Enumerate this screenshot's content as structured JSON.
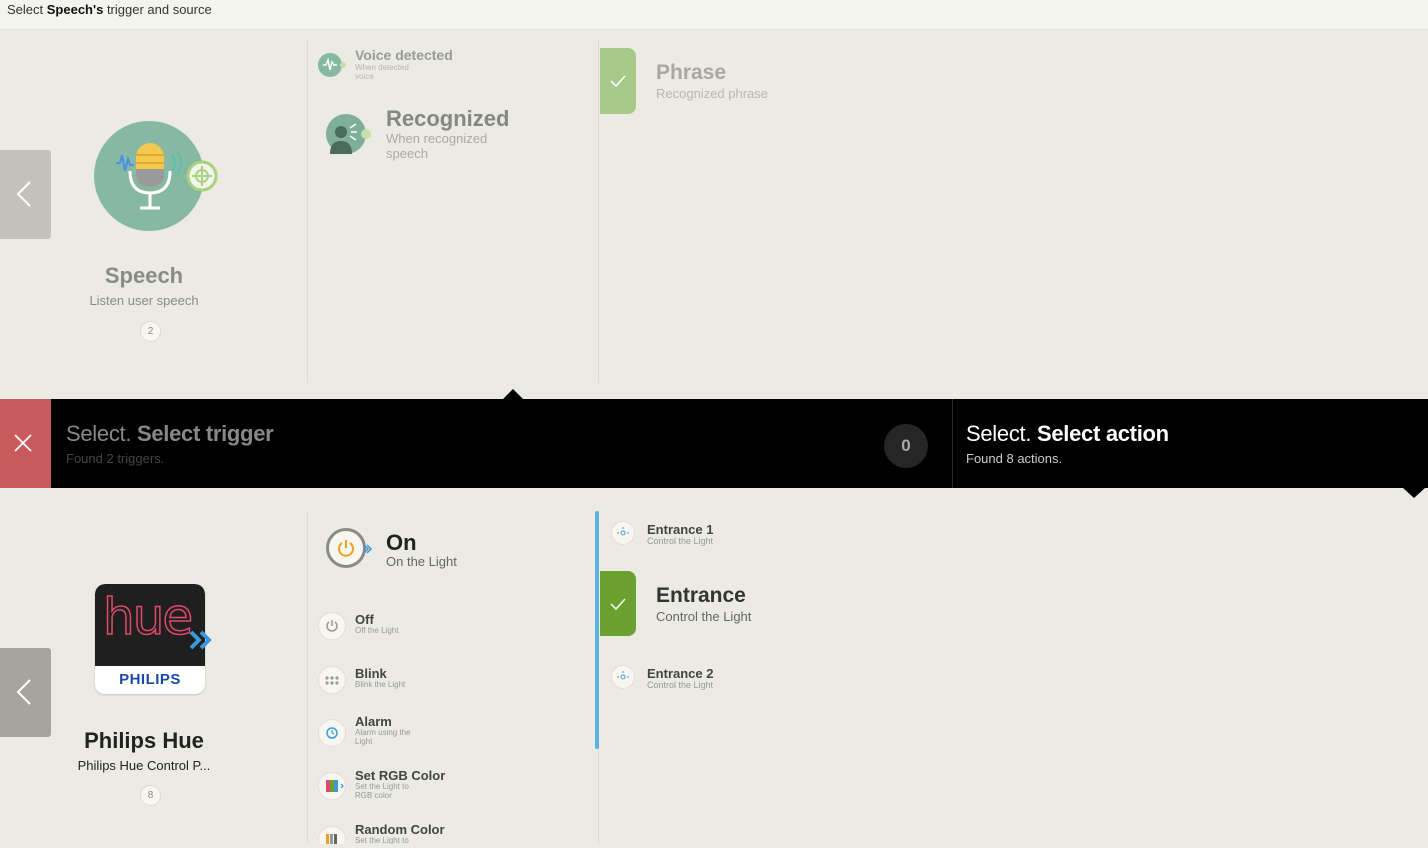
{
  "header": {
    "prefix": "Select ",
    "device_name": "Speech's",
    "suffix": " trigger and source"
  },
  "trigger_device": {
    "name": "Speech",
    "description": "Listen user speech",
    "count": "2"
  },
  "trigger_events": [
    {
      "title": "Voice detected",
      "subtitle": "When detected voice"
    },
    {
      "title": "Recognized",
      "subtitle": "When recognized speech"
    }
  ],
  "trigger_options": [
    {
      "title": "Phrase",
      "subtitle": "Recognized phrase"
    }
  ],
  "select_bar": {
    "trigger": {
      "prefix": "Select.",
      "title": "Select trigger",
      "subtitle": "Found 2 triggers.",
      "count": "0"
    },
    "action": {
      "prefix": "Select.",
      "title": "Select action",
      "subtitle": "Found 8 actions."
    }
  },
  "action_device": {
    "name": "Philips Hue",
    "description": "Philips Hue Control P...",
    "count": "8",
    "logo_text": "hue",
    "logo_brand": "PHILIPS"
  },
  "actions": [
    {
      "title": "On",
      "subtitle": "On the Light"
    },
    {
      "title": "Off",
      "subtitle": "Off the Light"
    },
    {
      "title": "Blink",
      "subtitle": "Blink the Light"
    },
    {
      "title": "Alarm",
      "subtitle": "Alarm using the Light"
    },
    {
      "title": "Set RGB Color",
      "subtitle": "Set the Light to RGB color"
    },
    {
      "title": "Random Color",
      "subtitle": "Set the Light to"
    }
  ],
  "action_targets": [
    {
      "title": "Entrance 1",
      "subtitle": "Control the Light"
    },
    {
      "title": "Entrance",
      "subtitle": "Control the Light"
    },
    {
      "title": "Entrance 2",
      "subtitle": "Control the Light"
    }
  ],
  "colors": {
    "accent_green": "#6aa12f",
    "close_red": "#c85a5c",
    "scroll_blue": "#5ab2e0",
    "bar_bg": "#000000"
  }
}
